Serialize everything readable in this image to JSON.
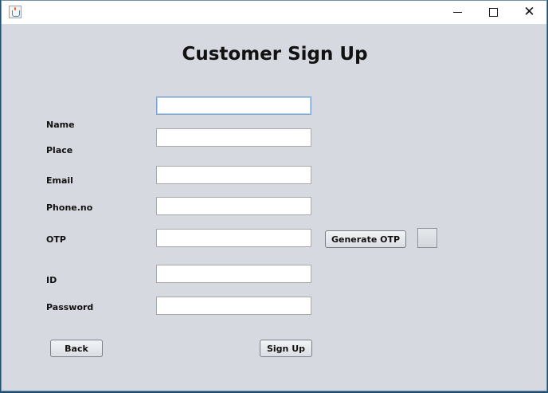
{
  "window": {
    "title": ""
  },
  "heading": "Customer Sign Up",
  "form": {
    "name": {
      "label": "Name",
      "value": ""
    },
    "place": {
      "label": "Place",
      "value": ""
    },
    "email": {
      "label": "Email",
      "value": ""
    },
    "phone": {
      "label": "Phone.no",
      "value": ""
    },
    "otp": {
      "label": "OTP",
      "value": ""
    },
    "id": {
      "label": "ID",
      "value": ""
    },
    "password": {
      "label": "Password",
      "value": ""
    }
  },
  "buttons": {
    "generate_otp": "Generate OTP",
    "back": "Back",
    "sign_up": "Sign Up"
  },
  "icons": {
    "app": "java-cup-icon",
    "minimize": "minimize-icon",
    "maximize": "maximize-icon",
    "close": "close-icon"
  }
}
